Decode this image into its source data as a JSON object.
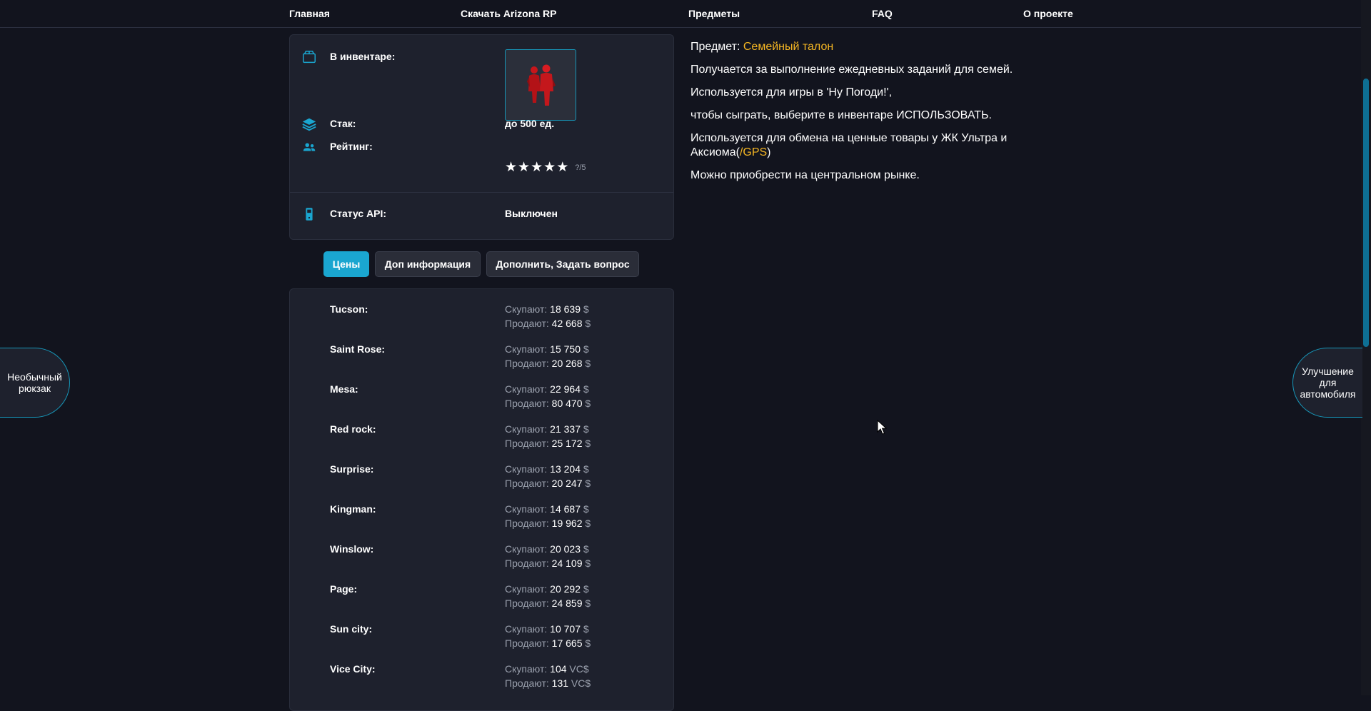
{
  "nav": {
    "home": "Главная",
    "download": "Скачать Arizona RP",
    "items": "Предметы",
    "faq": "FAQ",
    "about": "О проекте"
  },
  "info": {
    "inventory_label": "В инвентаре:",
    "stack_label": "Стак:",
    "stack_value": "до 500 ед.",
    "rating_label": "Рейтинг:",
    "rating_stars": 5,
    "rating_note": "?/5",
    "api_label": "Статус API:",
    "api_value": "Выключен"
  },
  "tabs": {
    "prices": "Цены",
    "extra": "Доп информация",
    "ask": "Дополнить, Задать вопрос"
  },
  "price_labels": {
    "buy": "Скупают:",
    "sell": "Продают:"
  },
  "prices": [
    {
      "city": "Tucson:",
      "buy": "18 639",
      "sell": "42 668",
      "currency": "$"
    },
    {
      "city": "Saint Rose:",
      "buy": "15 750",
      "sell": "20 268",
      "currency": "$"
    },
    {
      "city": "Mesa:",
      "buy": "22 964",
      "sell": "80 470",
      "currency": "$"
    },
    {
      "city": "Red rock:",
      "buy": "21 337",
      "sell": "25 172",
      "currency": "$"
    },
    {
      "city": "Surprise:",
      "buy": "13 204",
      "sell": "20 247",
      "currency": "$"
    },
    {
      "city": "Kingman:",
      "buy": "14 687",
      "sell": "19 962",
      "currency": "$"
    },
    {
      "city": "Winslow:",
      "buy": "20 023",
      "sell": "24 109",
      "currency": "$"
    },
    {
      "city": "Page:",
      "buy": "20 292",
      "sell": "24 859",
      "currency": "$"
    },
    {
      "city": "Sun city:",
      "buy": "10 707",
      "sell": "17 665",
      "currency": "$"
    },
    {
      "city": "Vice City:",
      "buy": "104",
      "sell": "131",
      "currency": "VC$"
    }
  ],
  "description": {
    "item_prefix": "Предмет:",
    "item_name": "Семейный талон",
    "line1": "Получается за выполнение ежедневных заданий для семей.",
    "line2": "Используется для игры в 'Ну Погоди!',",
    "line3": "чтобы сыграть, выберите в инвентаре ИСПОЛЬЗОВАТЬ.",
    "line4a": "Используется для обмена на ценные товары у ЖК Ультра и Аксиома(",
    "line4link": "/GPS",
    "line4b": ")",
    "line5": "Можно приобрести на центральном рынке."
  },
  "side": {
    "left": "Необычный рюкзак",
    "right": "Улучшение для автомобиля"
  },
  "colors": {
    "accent": "#1aa6d0",
    "highlight": "#f5b623",
    "background": "#12141e",
    "card": "#1e212d"
  },
  "icons": {
    "inventory": "box-icon",
    "stack": "layers-icon",
    "rating": "users-icon",
    "api": "phone-icon"
  }
}
